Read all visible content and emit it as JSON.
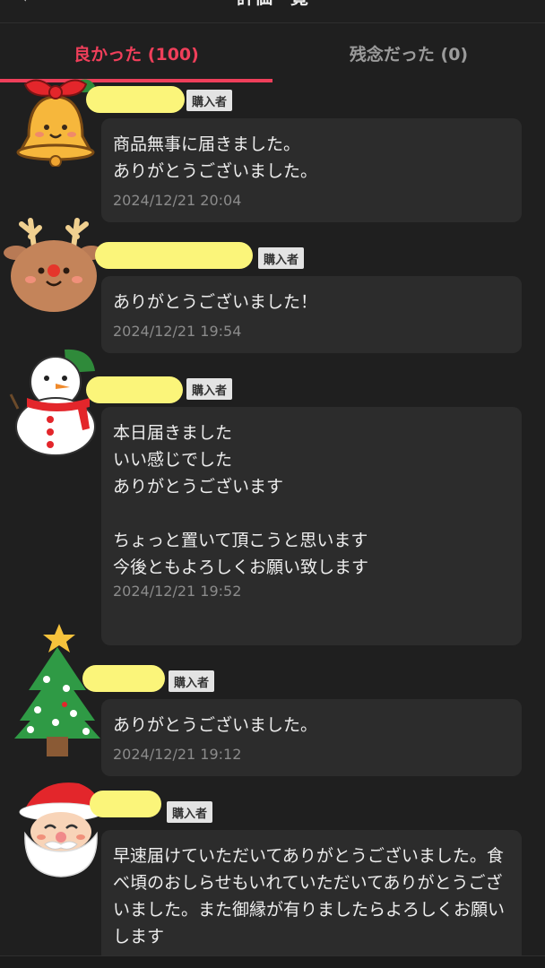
{
  "header": {
    "title": "評価一覧",
    "back_icon": "chevron-left-icon"
  },
  "tabs": [
    {
      "label": "良かった (100)",
      "active": true
    },
    {
      "label": "残念だった (0)",
      "active": false
    }
  ],
  "colors": {
    "accent": "#ef3f5a",
    "name_mask": "#fbf57a",
    "bubble": "#2c2c2c",
    "background": "#1f1f1f"
  },
  "reviews": [
    {
      "avatar": "bell-icon",
      "badge": "購入者",
      "text": "商品無事に届きました。\nありがとうございました。",
      "date": "2024/12/21 20:04"
    },
    {
      "avatar": "reindeer-icon",
      "badge": "購入者",
      "text": "ありがとうございました！",
      "date": "2024/12/21 19:54"
    },
    {
      "avatar": "snowman-icon",
      "badge": "購入者",
      "text": "本日届きました\nいい感じでした\nありがとうございます\n\nちょっと置いて頂こうと思います\n今後ともよろしくお願い致します\n",
      "date": "2024/12/21 19:52"
    },
    {
      "avatar": "christmas-tree-icon",
      "badge": "購入者",
      "text": "ありがとうございました。",
      "date": "2024/12/21 19:12"
    },
    {
      "avatar": "santa-icon",
      "badge": "購入者",
      "text": "早速届けていただいてありがとうございました。食べ頃のおしらせもいれていただいてありがとうございました。また御縁が有りましたらよろしくお願いします",
      "date": ""
    }
  ]
}
